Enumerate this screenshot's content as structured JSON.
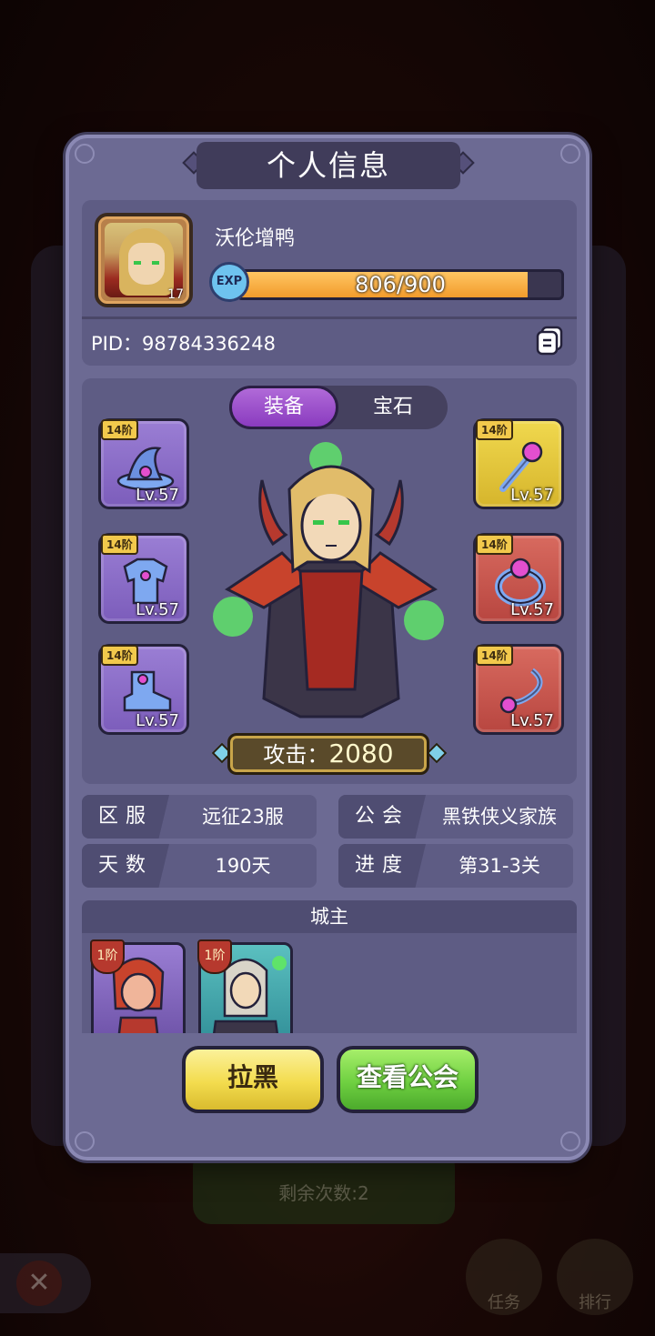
{
  "background": {
    "bottom_button_label": "剩余次数:2",
    "close_icon": "close-icon",
    "round_buttons": [
      {
        "label": "任务",
        "icon": "task-icon"
      },
      {
        "label": "排行",
        "icon": "trophy-icon"
      }
    ]
  },
  "dialog": {
    "title": "个人信息",
    "profile": {
      "nickname": "沃伦增鸭",
      "avatar_level": "17",
      "exp_label": "EXP",
      "exp_current": 806,
      "exp_max": 900,
      "exp_text": "806/900",
      "pid_text": "PID：98784336248",
      "copy_icon": "copy-icon"
    },
    "tabs": [
      {
        "label": "装备",
        "active": true
      },
      {
        "label": "宝石",
        "active": false
      }
    ],
    "equipment": {
      "left": [
        {
          "tier": "14阶",
          "level": "Lv.57",
          "item": "wizard-hat-icon",
          "rarity": "purple"
        },
        {
          "tier": "14阶",
          "level": "Lv.57",
          "item": "armor-icon",
          "rarity": "purple"
        },
        {
          "tier": "14阶",
          "level": "Lv.57",
          "item": "boots-icon",
          "rarity": "purple"
        }
      ],
      "right": [
        {
          "tier": "14阶",
          "level": "Lv.57",
          "item": "staff-icon",
          "rarity": "gold"
        },
        {
          "tier": "14阶",
          "level": "Lv.57",
          "item": "ring-icon",
          "rarity": "red"
        },
        {
          "tier": "14阶",
          "level": "Lv.57",
          "item": "necklace-icon",
          "rarity": "red"
        }
      ]
    },
    "attack": {
      "label": "攻击：",
      "value": "2080"
    },
    "info": {
      "server": {
        "key": "区服",
        "value": "远征23服"
      },
      "guild": {
        "key": "公会",
        "value": "黑铁侠义家族"
      },
      "days": {
        "key": "天数",
        "value": "190天"
      },
      "progress": {
        "key": "进度",
        "value": "第31-3关"
      }
    },
    "city_lord": {
      "title": "城主",
      "heroes": [
        {
          "tier": "1阶",
          "rarity": "purple"
        },
        {
          "tier": "1阶",
          "rarity": "teal"
        }
      ]
    },
    "buttons": {
      "block": "拉黑",
      "view_guild": "查看公会"
    }
  },
  "colors": {
    "dialog_bg": "#6c6a93",
    "exp_fill": "#f29c2c",
    "tab_active": "#8a3bbf",
    "btn_yellow": "#f3dc4e",
    "btn_green": "#6fd041"
  }
}
